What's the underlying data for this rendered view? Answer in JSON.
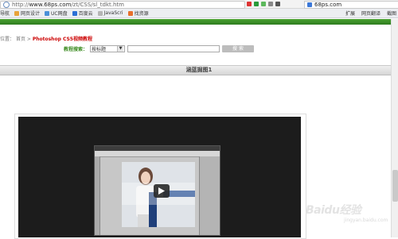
{
  "browser": {
    "url_prefix": "http://",
    "url_host": "www.68ps.com",
    "url_path": "/zt/CSS/sl_tdkt.htm",
    "search_text": "68ps.com",
    "bookmarks": [
      "导航",
      "网页设计",
      "UC网盘",
      "百度云",
      "JavaScri",
      "找资源"
    ],
    "bookmark_right": [
      "扩展",
      "网页翻译",
      "截图"
    ]
  },
  "page": {
    "breadcrumb_prefix": "位置：",
    "breadcrumb_home": "首页",
    "breadcrumb_sep": ">",
    "breadcrumb_current": "Photoshop CS5视频教程",
    "search_label": "教程搜索：",
    "search_select": "按标题",
    "search_button": "搜 索",
    "section_title": "涵蓝掘图1"
  },
  "watermark": {
    "logo": "Baidu经验",
    "sub": "jingyan.baidu.com"
  },
  "colors": {
    "brand_green": "#3a8b1f",
    "crumb_red": "#cc0000",
    "player_bg": "#1c1c1c"
  }
}
